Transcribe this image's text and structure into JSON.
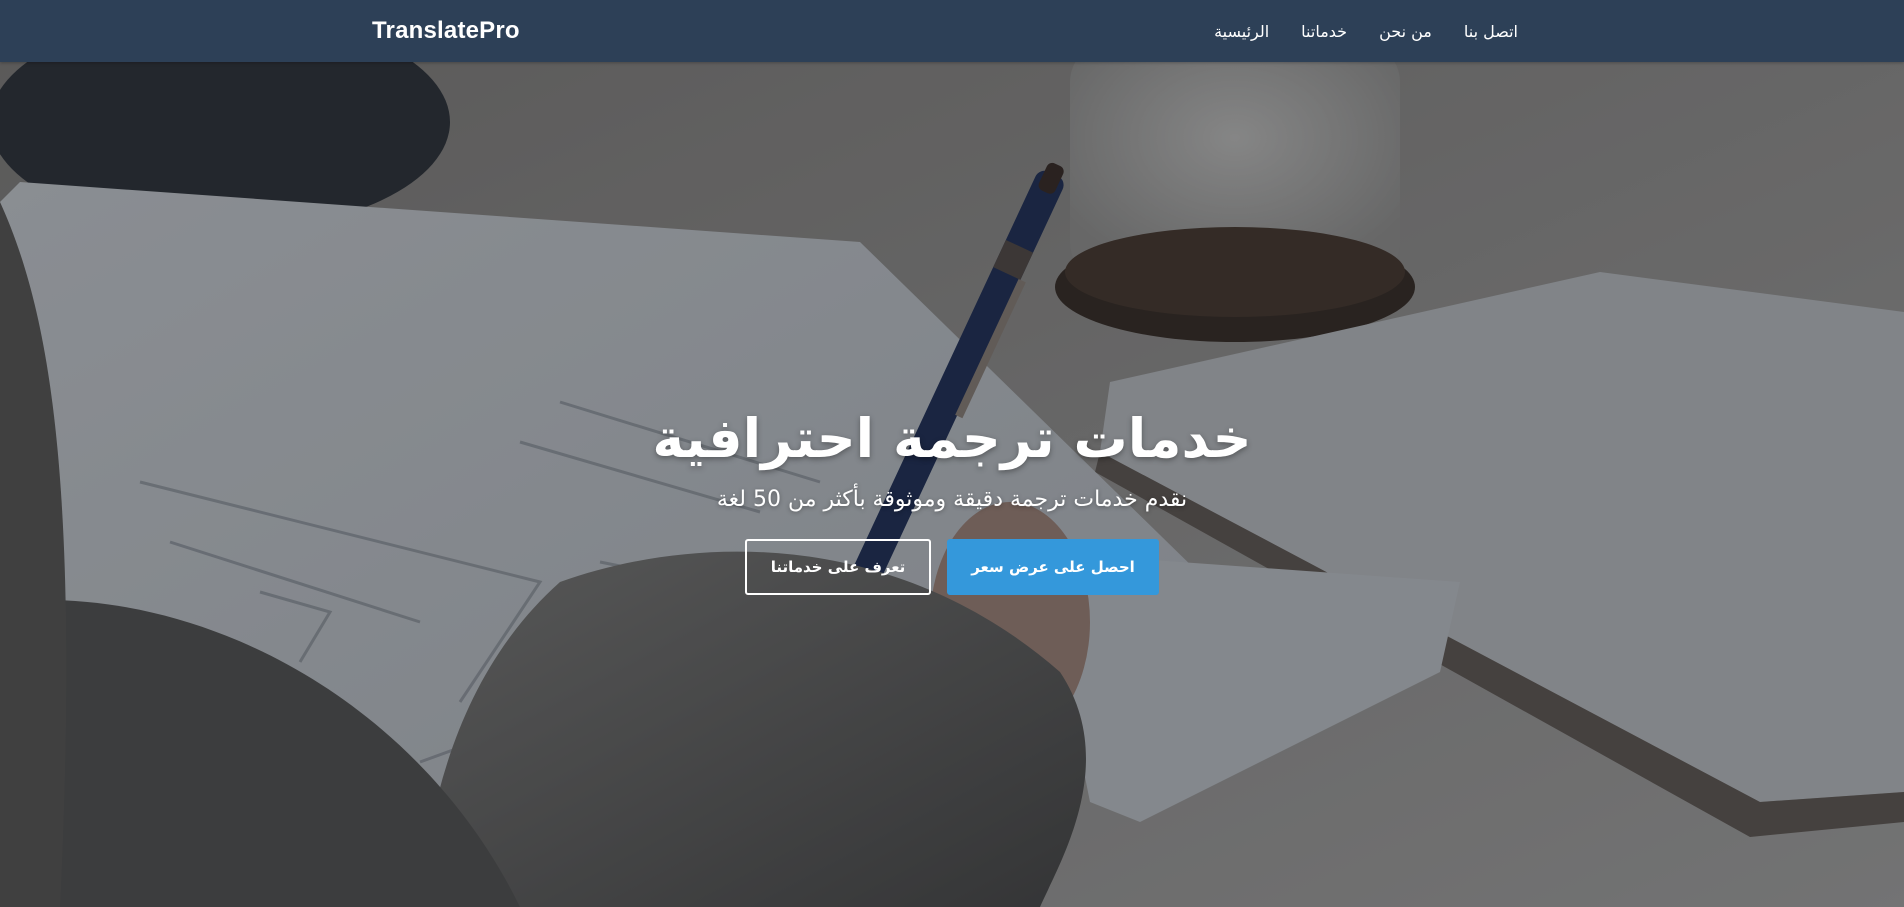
{
  "brand": {
    "name": "TranslatePro"
  },
  "nav": {
    "items": [
      {
        "label": "الرئيسية"
      },
      {
        "label": "خدماتنا"
      },
      {
        "label": "من نحن"
      },
      {
        "label": "اتصل بنا"
      }
    ]
  },
  "hero": {
    "title": "خدمات ترجمة احترافية",
    "subtitle": "نقدم خدمات ترجمة دقيقة وموثوقة بأكثر من 50 لغة",
    "primary_button": "احصل على عرض سعر",
    "secondary_button": "تعرف على خدماتنا"
  },
  "colors": {
    "navbar": "#2d4057",
    "primary": "#3498db",
    "text": "#ffffff"
  }
}
